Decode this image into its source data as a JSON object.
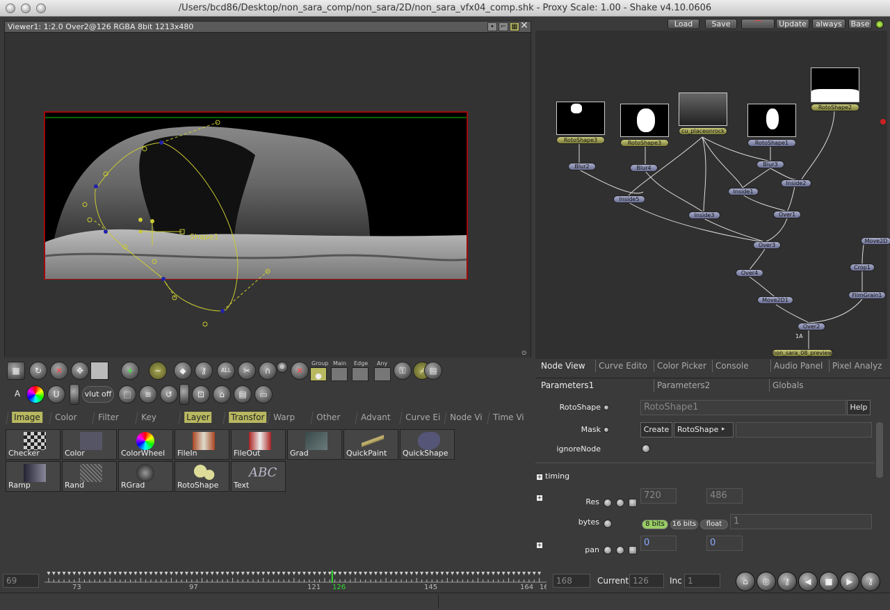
{
  "window": {
    "title": "/Users/bcd86/Desktop/non_sara_comp/non_sara/2D/non_sara_vfx04_comp.shk - Proxy Scale: 1.00 - Shake v4.10.0606"
  },
  "viewer": {
    "header": "Viewer1: 1:2.0 Over2@126 RGBA 8bit 1213x480",
    "shape_label": "Shape1"
  },
  "viewer_tools": {
    "group_label": "Group",
    "main_label": "Main",
    "edge_label": "Edge",
    "any_label": "Any",
    "vlut_label": "vlut off"
  },
  "tool_tabs": [
    "Image",
    "Color",
    "Filter",
    "Key",
    "Layer",
    "Transfor",
    "Warp",
    "Other",
    "Advant",
    "Curve Ei",
    "Node Vi",
    "Time Vi"
  ],
  "tools": [
    "Checker",
    "Color",
    "ColorWheel",
    "FileIn",
    "FileOut",
    "Grad",
    "QuickPaint",
    "QuickShape",
    "Ramp",
    "Rand",
    "RGrad",
    "RotoShape",
    "Text"
  ],
  "text_tool_glyph": "ABC",
  "top_buttons": {
    "load": "Load",
    "save": "Save",
    "update": "Update",
    "always": "always",
    "base": "Base"
  },
  "nodes": {
    "rotoshape3": "RotoShape3",
    "rotoshape4": "RotoShape3",
    "cu_placeonrock": "cu_placeonrock",
    "rotoshape1": "RotoShape1",
    "rotoshape2": "RotoShape2",
    "blur2": "Blur2",
    "blur4": "Blur4",
    "blur3": "Blur3",
    "inside1": "Inside1",
    "inside2": "Inside2",
    "inside5": "Inside5",
    "inside3": "Inside3",
    "over1": "Over1",
    "over3": "Over3",
    "over4": "Over4",
    "move2d1": "Move2D1",
    "over2": "Over2",
    "preview": "non_sara_08_preview",
    "move2d2": "Move2D",
    "crop1": "Crop1",
    "filmgrain1": "FilmGrain1",
    "tag_1a": "1A"
  },
  "view_tabs": [
    "Node View",
    "Curve Edito",
    "Color Picker",
    "Console",
    "Audio Panel",
    "Pixel Analyz"
  ],
  "param_tabs": [
    "Parameters1",
    "Parameters2",
    "Globals"
  ],
  "params": {
    "rotoshape_label": "RotoShape",
    "rotoshape_value": "RotoShape1",
    "help": "Help",
    "mask_label": "Mask",
    "create": "Create",
    "mask_value": "RotoShape",
    "ignore_label": "ignoreNode",
    "timing_label": "timing",
    "res_label": "Res",
    "res_w": "720",
    "res_h": "486",
    "bytes_label": "bytes",
    "bytes_8": "8 bits",
    "bytes_16": "16 bits",
    "bytes_float": "float",
    "bytes_value": "1",
    "pan_label": "pan",
    "pan_x": "0",
    "pan_y": "0"
  },
  "timeline": {
    "start": "69",
    "end": "168",
    "ticks": [
      "73",
      "97",
      "121",
      "126",
      "145",
      "164",
      "16"
    ],
    "current_label": "Current",
    "current": "126",
    "inc_label": "Inc",
    "inc": "1",
    "current_frame_fraction": 0.587
  }
}
